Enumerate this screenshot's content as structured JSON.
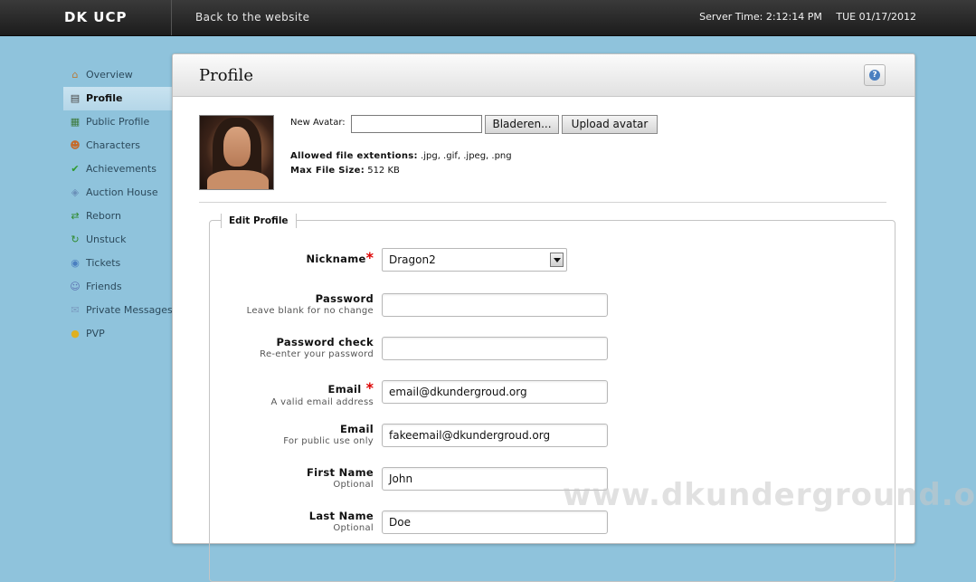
{
  "header": {
    "brand": "DK UCP",
    "back_link": "Back to the website",
    "server_time": "Server Time: 2:12:14 PM",
    "server_date": "TUE 01/17/2012"
  },
  "sidebar": {
    "items": [
      {
        "label": "Overview",
        "icon": "home-icon"
      },
      {
        "label": "Profile",
        "icon": "profile-card-icon",
        "active": true
      },
      {
        "label": "Public Profile",
        "icon": "public-profile-icon"
      },
      {
        "label": "Characters",
        "icon": "characters-icon"
      },
      {
        "label": "Achievements",
        "icon": "checkmark-icon"
      },
      {
        "label": "Auction House",
        "icon": "tag-icon"
      },
      {
        "label": "Reborn",
        "icon": "reborn-icon"
      },
      {
        "label": "Unstuck",
        "icon": "unstuck-icon"
      },
      {
        "label": "Tickets",
        "icon": "ticket-icon"
      },
      {
        "label": "Friends",
        "icon": "friends-icon"
      },
      {
        "label": "Private Messages",
        "icon": "messages-icon"
      },
      {
        "label": "PVP",
        "icon": "pvp-icon"
      }
    ]
  },
  "main": {
    "title": "Profile",
    "help_icon": "?",
    "avatar": {
      "new_avatar_label": "New Avatar:",
      "browse_button": "Bladeren...",
      "upload_button": "Upload avatar",
      "extensions_label": "Allowed file extentions:",
      "extensions_value": ".jpg, .gif, .jpeg, .png",
      "max_size_label": "Max File Size:",
      "max_size_value": "512 KB"
    },
    "form": {
      "legend": "Edit Profile",
      "nickname": {
        "label": "Nickname",
        "required": "*",
        "value": "Dragon2"
      },
      "password": {
        "label": "Password",
        "hint": "Leave blank for no change",
        "value": ""
      },
      "password_check": {
        "label": "Password check",
        "hint": "Re-enter your password",
        "value": ""
      },
      "email": {
        "label": "Email",
        "required": "*",
        "hint": "A valid email address",
        "value": "email@dkundergroud.org"
      },
      "public_email": {
        "label": "Email",
        "hint": "For public use only",
        "value": "fakeemail@dkundergroud.org"
      },
      "first_name": {
        "label": "First Name",
        "hint": "Optional",
        "value": "John"
      },
      "last_name": {
        "label": "Last Name",
        "hint": "Optional",
        "value": "Doe"
      }
    }
  },
  "watermark": "www.dkunderground.org",
  "colors": {
    "background": "#8fc3dc",
    "topbar": "#1c1c1c",
    "active_nav": "#b4d6e8",
    "required": "#dd0000"
  }
}
